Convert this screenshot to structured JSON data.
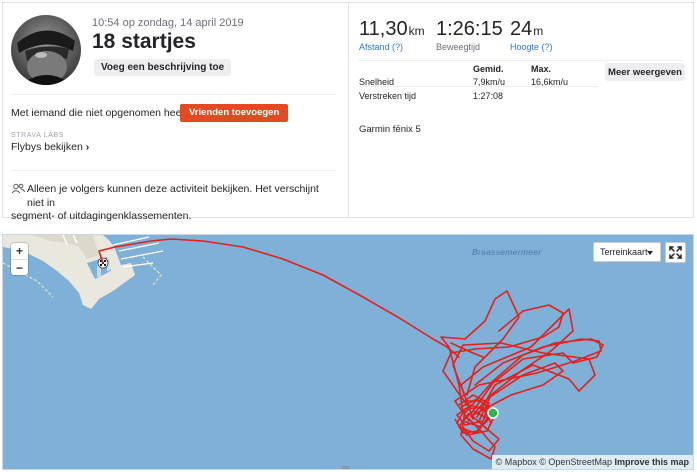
{
  "activity": {
    "datetime": "10:54 op zondag, 14 april 2019",
    "title": "18 startjes",
    "add_description_label": "Voeg een beschrijving toe",
    "untagged_question": "Met iemand die niet opgenomen heeft?",
    "add_friends_label": "Vrienden toevoegen",
    "labs_label": "STRAVA LABS",
    "flyby_label": "Flybys bekijken",
    "privacy_line1": "Alleen je volgers kunnen deze activiteit bekijken. Het verschijnt niet in",
    "privacy_line2": "segment- of uitdagingenklassementen."
  },
  "stats": {
    "distance": {
      "value": "11,30",
      "unit": "km",
      "label": "Afstand (?)"
    },
    "moving_time": {
      "value": "1:26:15",
      "label": "Beweegtijd"
    },
    "elevation": {
      "value": "24",
      "unit": "m",
      "label": "Hoogte (?)"
    },
    "table": {
      "col_avg": "Gemid.",
      "col_max": "Max.",
      "rows": [
        {
          "label": "Snelheid",
          "avg": "7,9km/u",
          "max": "16,6km/u"
        },
        {
          "label": "Verstreken tijd",
          "avg": "1:27:08",
          "max": ""
        }
      ]
    },
    "more_label": "Meer weergeven",
    "device": "Garmin fēnix 5"
  },
  "map": {
    "zoom_in": "+",
    "zoom_out": "−",
    "map_type": "Terreinkaart",
    "lake_label": "Braassemermeer",
    "attribution_mapbox": "© Mapbox",
    "attribution_osm": "© OpenStreetMap",
    "improve_label": "Improve this map",
    "water_color": "#7fb0d8",
    "track_color": "#e3201b",
    "start_marker_color": "#2fb24a",
    "fullscreen_icon": "expand-arrows-icon",
    "finish_icon": "checkered-flag-icon"
  }
}
